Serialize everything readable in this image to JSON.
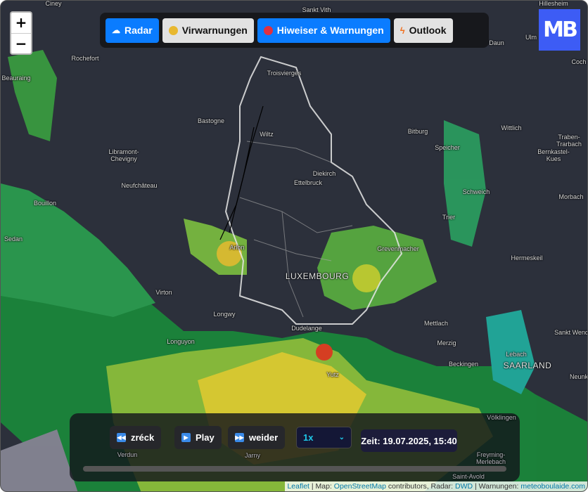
{
  "zoom": {
    "in": "+",
    "out": "−"
  },
  "tabs": [
    {
      "label": "Radar",
      "icon": "cloud-rain-icon",
      "active": true
    },
    {
      "label": "Virwarnungen",
      "icon": "yellow-dot-icon",
      "active": false
    },
    {
      "label": "Hiweiser & Warnungen",
      "icon": "red-dot-icon",
      "active": true
    },
    {
      "label": "Outlook",
      "icon": "lightning-icon",
      "active": false
    }
  ],
  "logo": "MB",
  "towns": [
    "Sankt Vith",
    "Hillesheim",
    "Daun",
    "Rochefort",
    "Beauraing",
    "Troisvierges",
    "Bastogne",
    "Wiltz",
    "Bitburg",
    "Wittlich",
    "Traben-Trarbach",
    "Libramont-Chevigny",
    "Diekirch",
    "Ettelbruck",
    "Bernkastel-Kues",
    "Speicher",
    "Neufchâteau",
    "Schweich",
    "Morbach",
    "Bouillon",
    "Sedan",
    "Trier",
    "Arlon",
    "Grevenmacher",
    "Hermeskeil",
    "LUXEMBOURG",
    "Virton",
    "Longwy",
    "Mettlach",
    "Sankt Wendel",
    "Dudelange",
    "Longuyon",
    "Merzig",
    "Lebach",
    "Beckingen",
    "SAARLAND",
    "Yutz",
    "Verdun",
    "Jarny",
    "Völklingen",
    "Saint-Avold",
    "Freyming-Merlebach",
    "Ciney",
    "Ulm",
    "Coch",
    "Neunk"
  ],
  "controls": {
    "back": "zréck",
    "play": "Play",
    "forward": "weider",
    "speed": "1x",
    "time": "Zeit: 19.07.2025, 15:40",
    "progress": 0
  },
  "attribution": {
    "leaflet": "Leaflet",
    "map_prefix": " | Map: ",
    "osm": "OpenStreetMap",
    "radar_prefix": " contributors, Radar: ",
    "dwd": "DWD",
    "warn_prefix": " | Warnungen: ",
    "site": "meteoboulaide.com"
  },
  "colors": {
    "accent": "#0a7cff",
    "map_bg": "#2c303b",
    "logo": "#3d5cf5"
  }
}
